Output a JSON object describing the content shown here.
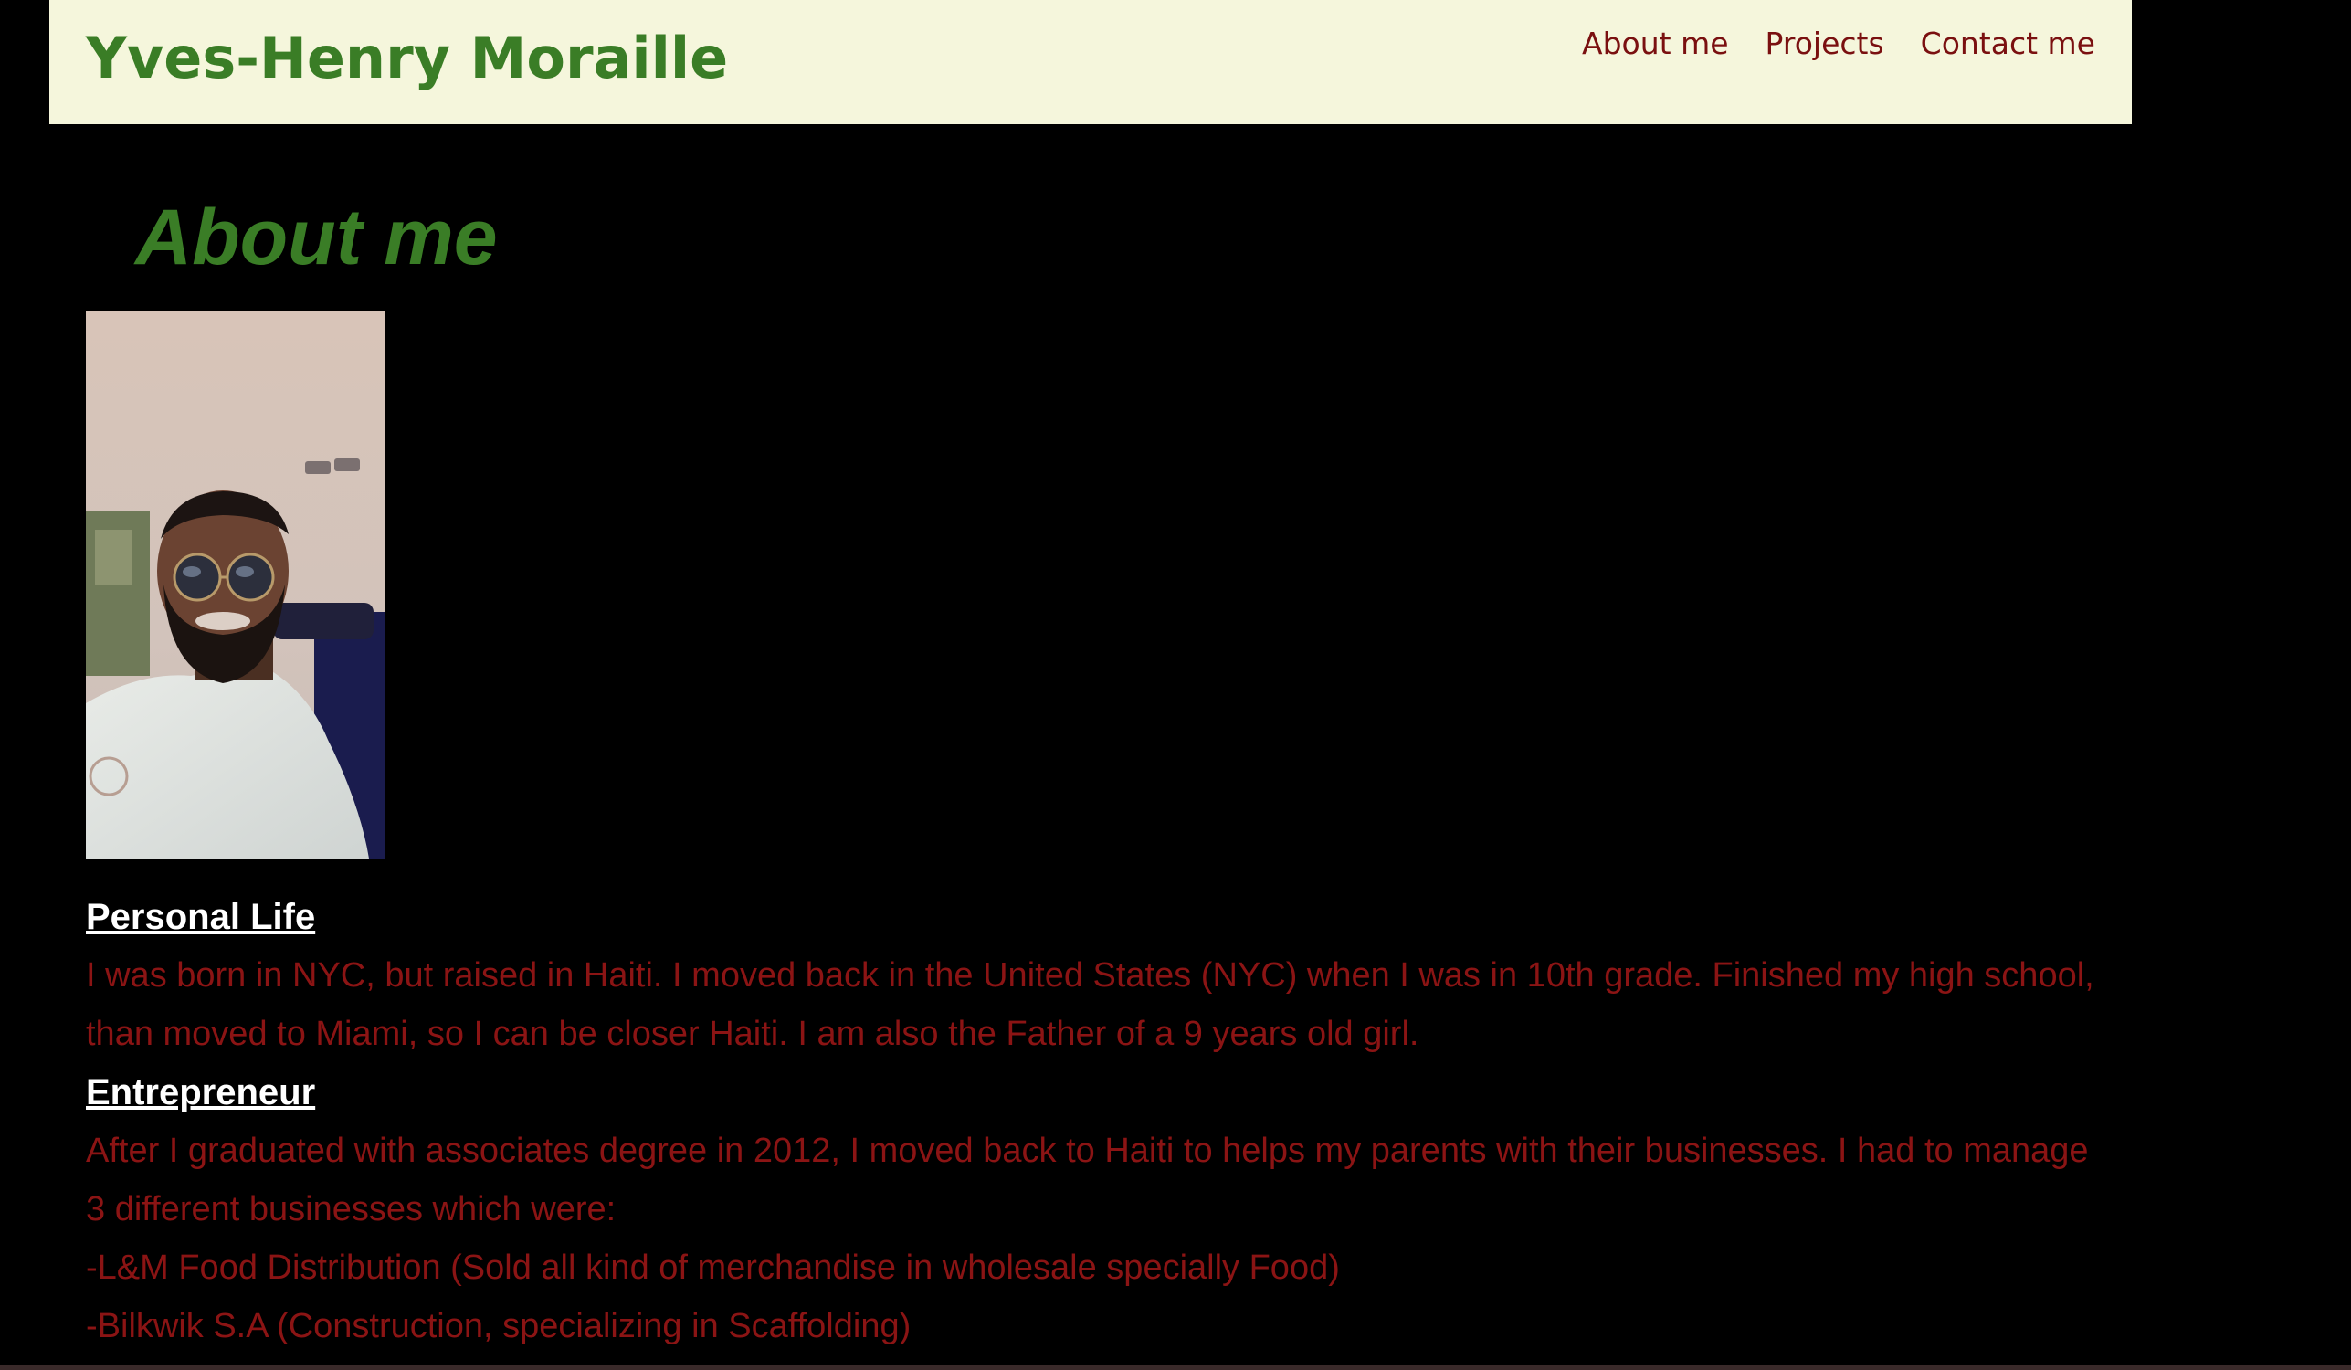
{
  "header": {
    "title": "Yves-Henry Moraille",
    "nav": [
      {
        "label": "About me"
      },
      {
        "label": "Projects"
      },
      {
        "label": "Contact me"
      }
    ]
  },
  "main": {
    "heading": "About me",
    "photo_alt": "Portrait photo of Yves-Henry Moraille",
    "sections": [
      {
        "title": "Personal Life",
        "paragraphs": [
          "I was born in NYC, but raised in Haiti. I moved back in the United States (NYC) when I was in 10th grade. Finished my high school, than moved to Miami, so I can be closer Haiti. I am also the Father of a 9 years old girl."
        ]
      },
      {
        "title": "Entrepreneur",
        "paragraphs": [
          "After I graduated with associates degree in 2012, I moved back to Haiti to helps my parents with their businesses. I had to manage 3 different businesses which were:",
          "-L&M Food Distribution (Sold all kind of merchandise in wholesale specially Food)",
          "-Bilkwik S.A (Construction, specializing in Scaffolding)"
        ]
      }
    ]
  },
  "colors": {
    "header_bg": "#f5f6dc",
    "title_green": "#3a7d26",
    "nav_red": "#7a1010",
    "body_text_red": "#8b1414",
    "section_title_white": "#ffffff",
    "page_bg": "#000000"
  }
}
